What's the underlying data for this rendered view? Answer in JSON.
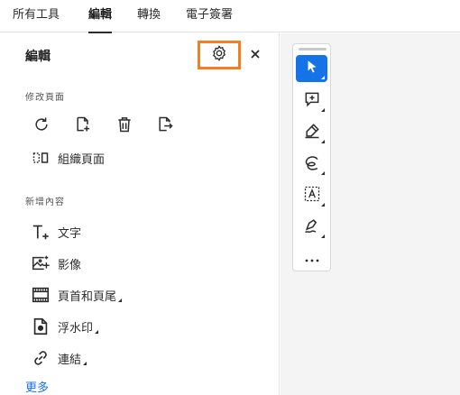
{
  "topnav": {
    "tabs": [
      {
        "label": "所有工具",
        "active": false
      },
      {
        "label": "編輯",
        "active": true
      },
      {
        "label": "轉換",
        "active": false
      },
      {
        "label": "電子簽署",
        "active": false
      }
    ]
  },
  "panel": {
    "title": "編輯",
    "settings_icon": "gear-icon",
    "close_icon": "close-icon",
    "modify_pages": {
      "label": "修改頁面",
      "actions": [
        "rotate-icon",
        "insert-page-icon",
        "delete-icon",
        "extract-icon"
      ],
      "organize_label": "組織頁面"
    },
    "add_content": {
      "label": "新增內容",
      "items": [
        {
          "label": "文字",
          "icon": "add-text-icon",
          "has_menu": false
        },
        {
          "label": "影像",
          "icon": "add-image-icon",
          "has_menu": false
        },
        {
          "label": "頁首和頁尾",
          "icon": "header-footer-icon",
          "has_menu": true
        },
        {
          "label": "浮水印",
          "icon": "watermark-icon",
          "has_menu": true
        },
        {
          "label": "連結",
          "icon": "link-icon",
          "has_menu": true
        }
      ]
    },
    "more_label": "更多"
  },
  "toolbar": {
    "tools": [
      "select-cursor-icon",
      "add-comment-icon",
      "highlight-pen-icon",
      "draw-freeform-icon",
      "text-box-icon",
      "sign-icon",
      "more-tools-icon"
    ],
    "active_tool": "select-cursor-icon"
  },
  "colors": {
    "accent": "#1473e6",
    "highlight_outline": "#f57f1f"
  }
}
